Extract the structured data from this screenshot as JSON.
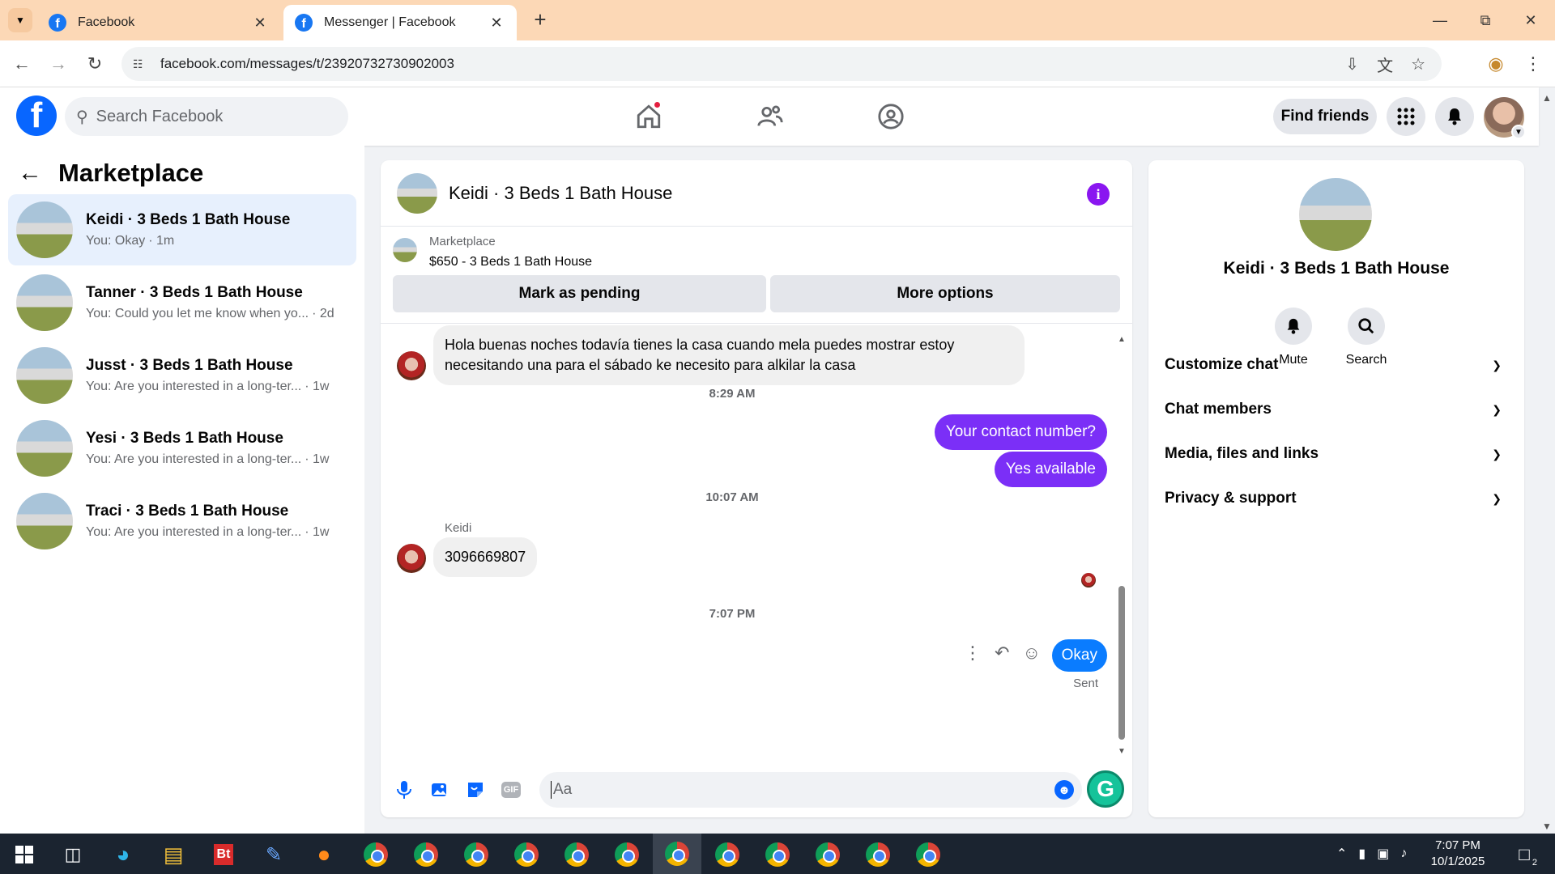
{
  "browser": {
    "tabs": [
      {
        "title": "Facebook",
        "active": false
      },
      {
        "title": "Messenger | Facebook",
        "active": true
      }
    ],
    "url": "facebook.com/messages/t/23920732730902003"
  },
  "fb": {
    "search_placeholder": "Search Facebook",
    "find_friends": "Find friends"
  },
  "sidebar": {
    "title": "Marketplace",
    "conversations": [
      {
        "name": "Keidi · 3 Beds 1 Bath House",
        "snippet": "You: Okay",
        "time": "· 1m",
        "selected": true
      },
      {
        "name": "Tanner · 3 Beds 1 Bath House",
        "snippet": "You: Could you let me know when yo...",
        "time": "· 2d",
        "selected": false
      },
      {
        "name": "Jusst · 3 Beds 1 Bath House",
        "snippet": "You: Are you interested in a long-ter...",
        "time": "· 1w",
        "selected": false
      },
      {
        "name": "Yesi · 3 Beds 1 Bath House",
        "snippet": "You: Are you interested in a long-ter...",
        "time": "· 1w",
        "selected": false
      },
      {
        "name": "Traci · 3 Beds 1 Bath House",
        "snippet": "You: Are you interested in a long-ter...",
        "time": "· 1w",
        "selected": false
      }
    ]
  },
  "chat": {
    "title": "Keidi · 3 Beds 1 Bath House",
    "marketplace_label": "Marketplace",
    "listing": "$650 - 3 Beds 1 Bath House",
    "mark_pending": "Mark as pending",
    "more_options": "More options",
    "messages": {
      "incoming_1": "Hola buenas noches todavía tienes la casa cuando mela puedes mostrar estoy necesitando una para el sábado ke necesito para alkilar la casa",
      "time_1": "8:29 AM",
      "outgoing_1": "Your contact number?",
      "outgoing_2": "Yes available",
      "time_2": "10:07 AM",
      "sender_name": "Keidi",
      "incoming_2": "3096669807",
      "time_3": "7:07 PM",
      "outgoing_3": "Okay",
      "status": "Sent"
    },
    "composer_placeholder": "Aa"
  },
  "info_panel": {
    "title": "Keidi · 3 Beds 1 Bath House",
    "actions": [
      {
        "label": "Mute",
        "icon": "bell-icon"
      },
      {
        "label": "Search",
        "icon": "search-icon"
      }
    ],
    "sections": [
      "Customize chat",
      "Chat members",
      "Media, files and links",
      "Privacy & support"
    ]
  },
  "taskbar": {
    "time": "7:07 PM",
    "date": "10/1/2025",
    "notification_count": "2"
  },
  "colors": {
    "brand_blue": "#0866ff",
    "outgoing_purple": "#7b2ff7",
    "last_message_blue": "#0a7cff",
    "info_purple": "#8a16f0"
  }
}
